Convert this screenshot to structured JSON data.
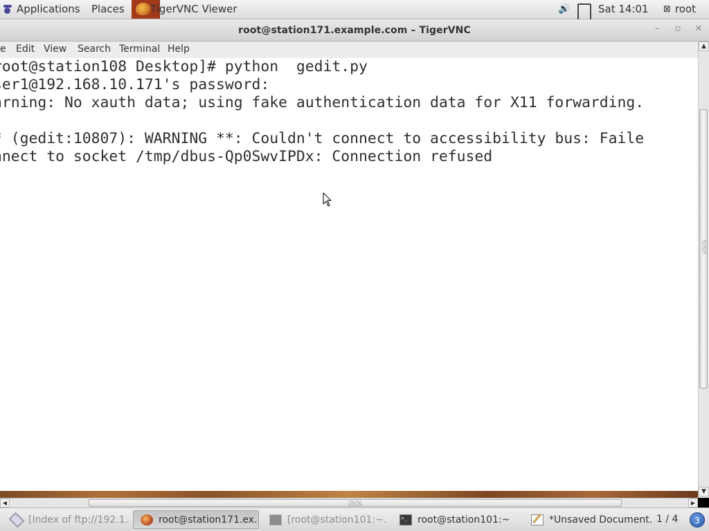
{
  "top_panel": {
    "applications_label": "Applications",
    "places_label": "Places",
    "vnc_app_label": "TigerVNC Viewer",
    "volume_icon": "speaker-icon",
    "network_icon": "network-icon",
    "clock": "Sat 14:01",
    "user_label": "root",
    "user_icon": "user-icon"
  },
  "window": {
    "title": "root@station171.example.com – TigerVNC",
    "minimize": "–",
    "maximize": "▫",
    "close": "✕"
  },
  "menubar": {
    "items": [
      "e",
      "Edit",
      "View",
      "Search",
      "Terminal",
      "Help"
    ]
  },
  "terminal": {
    "lines": [
      "root@station108 Desktop]# python  gedit.py",
      "ser1@192.168.10.171's password:",
      "arning: No xauth data; using fake authentication data for X11 forwarding.",
      "",
      "* (gedit:10807): WARNING **: Couldn't connect to accessibility bus: Faile",
      "nnect to socket /tmp/dbus-Qp0SwvIPDx: Connection refused"
    ]
  },
  "taskbar": {
    "tasks": [
      {
        "label": "[Index of ftp://192.1...",
        "icon": "web-icon",
        "state": "minimized"
      },
      {
        "label": "root@station171.ex...",
        "icon": "tigervnc-icon",
        "state": "active"
      },
      {
        "label": "[root@station101:~...",
        "icon": "terminal-icon",
        "state": "minimized"
      },
      {
        "label": "root@station101:~",
        "icon": "terminal-icon",
        "state": "normal"
      },
      {
        "label": "*Unsaved Document...",
        "icon": "text-editor-icon",
        "state": "normal"
      }
    ],
    "workspace": "1 / 4",
    "badge": "3"
  },
  "colors": {
    "terminal_bg": "#ffffff",
    "terminal_fg": "#2e2e2e",
    "panel_bg": "#e4e4e4"
  }
}
